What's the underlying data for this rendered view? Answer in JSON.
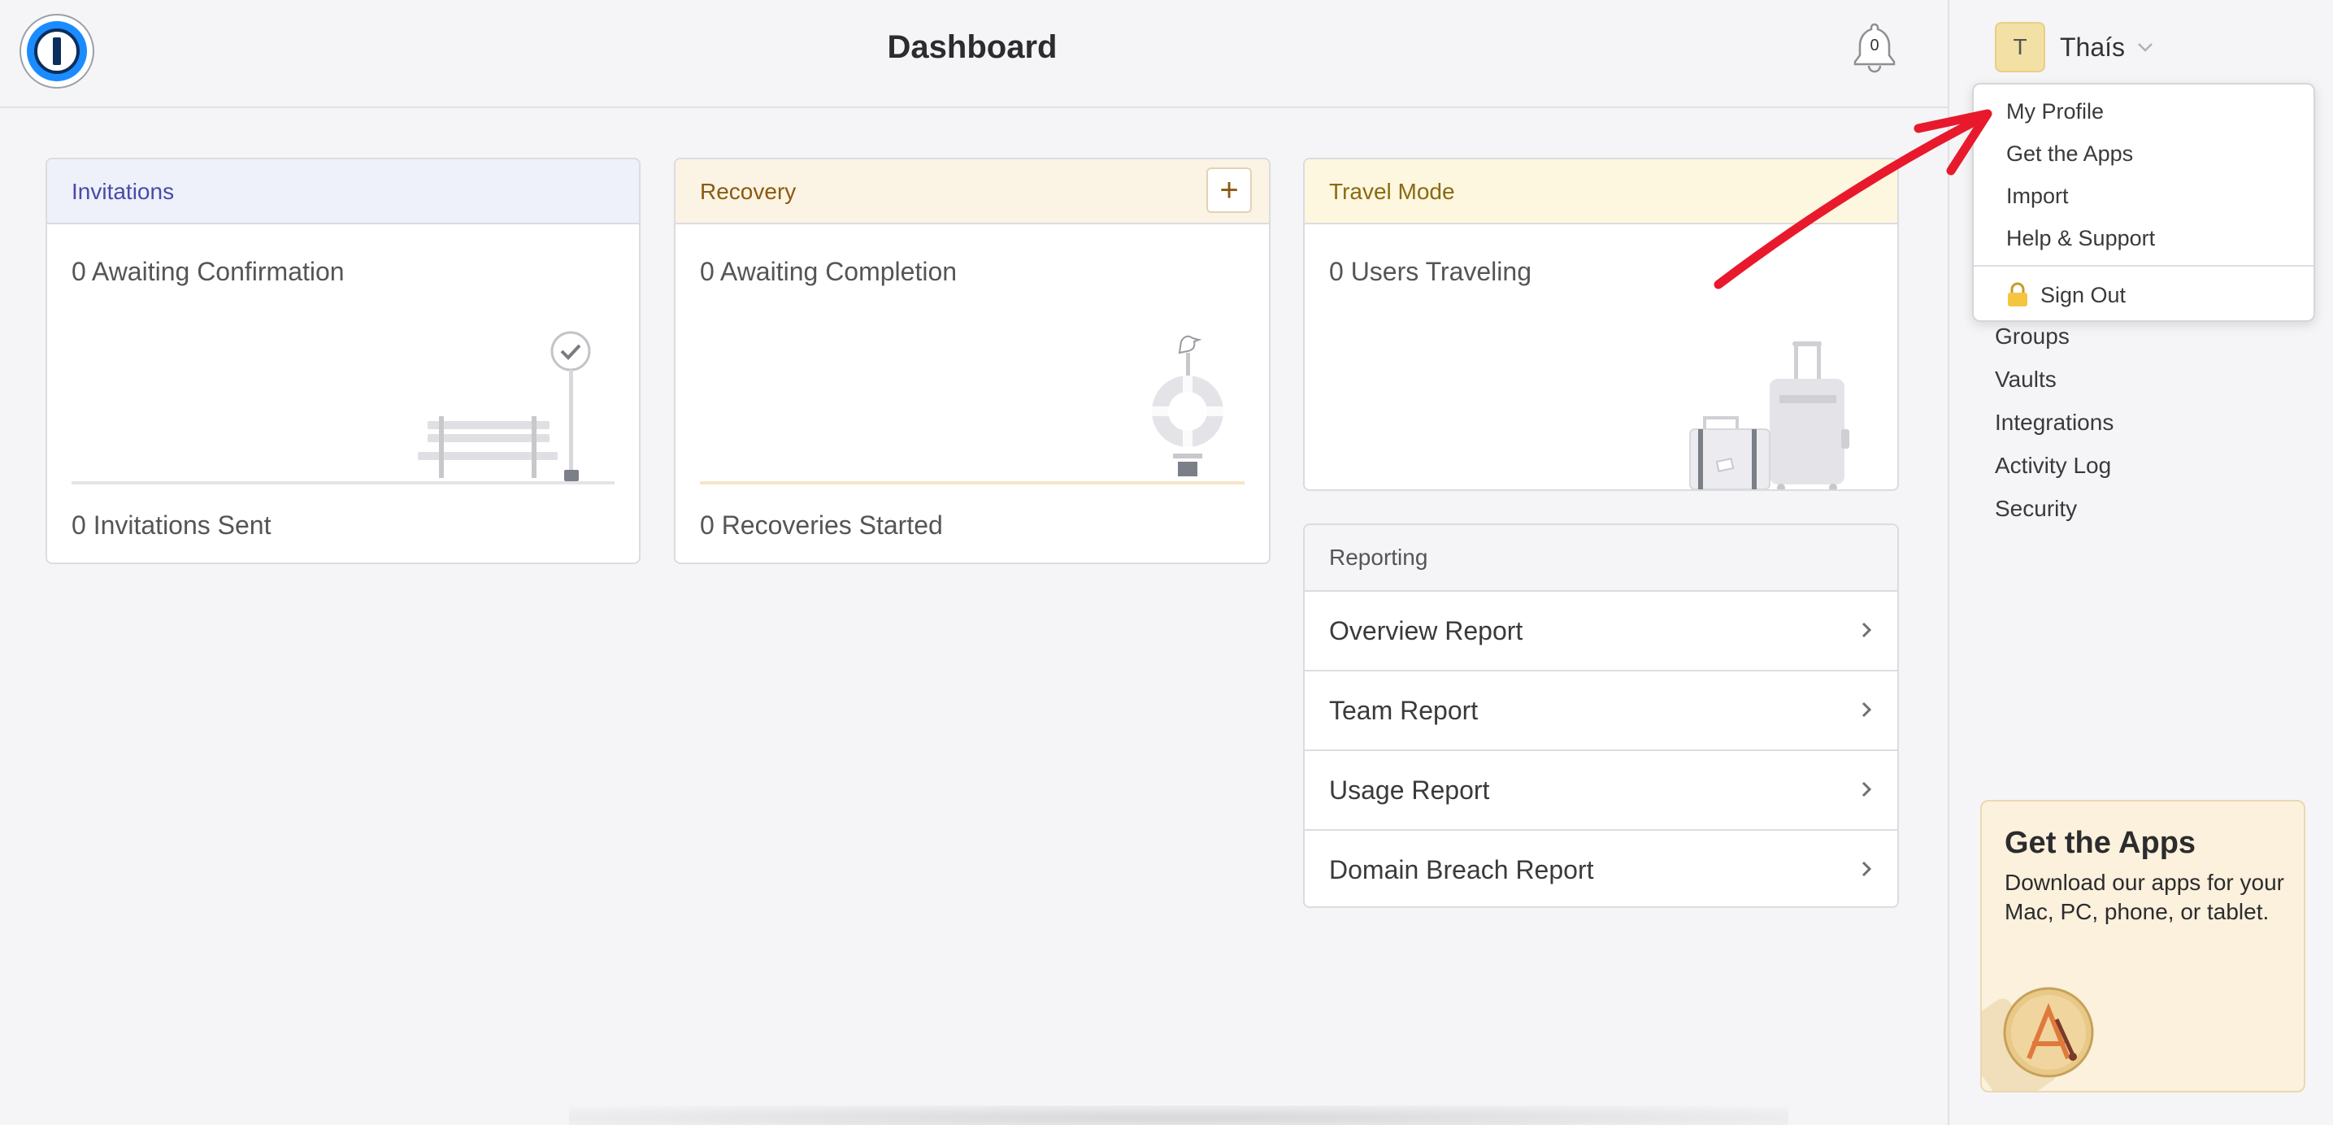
{
  "header": {
    "title": "Dashboard",
    "notification_count": "0"
  },
  "user": {
    "initial": "T",
    "name": "Thaís"
  },
  "dropdown": {
    "items": [
      "My Profile",
      "Get the Apps",
      "Import",
      "Help & Support"
    ],
    "sign_out": "Sign Out"
  },
  "sidebar": {
    "items": [
      "Groups",
      "Vaults",
      "Integrations",
      "Activity Log",
      "Security"
    ]
  },
  "cards": {
    "invitations": {
      "title": "Invitations",
      "main": "0 Awaiting Confirmation",
      "footer": "0 Invitations Sent"
    },
    "recovery": {
      "title": "Recovery",
      "main": "0 Awaiting Completion",
      "footer": "0 Recoveries Started",
      "add_label": "+"
    },
    "travel": {
      "title": "Travel Mode",
      "main": "0 Users Traveling"
    },
    "reporting": {
      "title": "Reporting",
      "rows": [
        "Overview Report",
        "Team Report",
        "Usage Report",
        "Domain Breach Report"
      ]
    }
  },
  "apps_promo": {
    "title": "Get the Apps",
    "description": "Download our apps for your Mac, PC, phone, or tablet."
  },
  "colors": {
    "invitations_header_bg": "#eef0fa",
    "invitations_header_text": "#4a4aa8",
    "recovery_header_bg": "#fbf3e3",
    "recovery_header_text": "#8a5a12",
    "travel_header_bg": "#fdf7df",
    "travel_header_text": "#8a6a12",
    "annotation_arrow": "#e8192c"
  }
}
